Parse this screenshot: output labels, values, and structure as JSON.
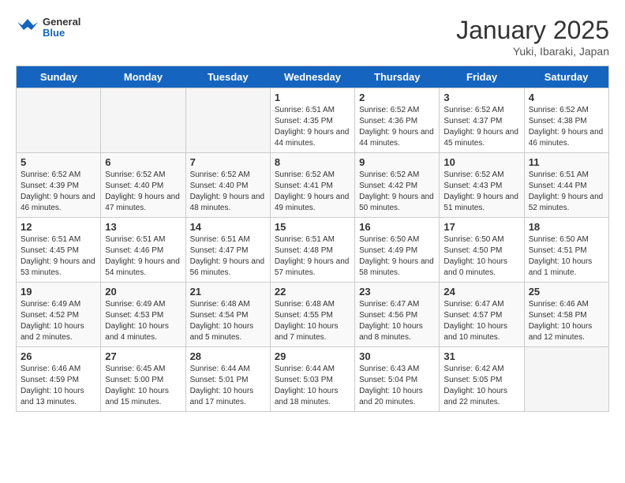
{
  "header": {
    "logo_general": "General",
    "logo_blue": "Blue",
    "title": "January 2025",
    "subtitle": "Yuki, Ibaraki, Japan"
  },
  "weekdays": [
    "Sunday",
    "Monday",
    "Tuesday",
    "Wednesday",
    "Thursday",
    "Friday",
    "Saturday"
  ],
  "weeks": [
    [
      {
        "day": "",
        "empty": true
      },
      {
        "day": "",
        "empty": true
      },
      {
        "day": "",
        "empty": true
      },
      {
        "day": "1",
        "sunrise": "Sunrise: 6:51 AM",
        "sunset": "Sunset: 4:35 PM",
        "daylight": "Daylight: 9 hours and 44 minutes."
      },
      {
        "day": "2",
        "sunrise": "Sunrise: 6:52 AM",
        "sunset": "Sunset: 4:36 PM",
        "daylight": "Daylight: 9 hours and 44 minutes."
      },
      {
        "day": "3",
        "sunrise": "Sunrise: 6:52 AM",
        "sunset": "Sunset: 4:37 PM",
        "daylight": "Daylight: 9 hours and 45 minutes."
      },
      {
        "day": "4",
        "sunrise": "Sunrise: 6:52 AM",
        "sunset": "Sunset: 4:38 PM",
        "daylight": "Daylight: 9 hours and 46 minutes."
      }
    ],
    [
      {
        "day": "5",
        "sunrise": "Sunrise: 6:52 AM",
        "sunset": "Sunset: 4:39 PM",
        "daylight": "Daylight: 9 hours and 46 minutes."
      },
      {
        "day": "6",
        "sunrise": "Sunrise: 6:52 AM",
        "sunset": "Sunset: 4:40 PM",
        "daylight": "Daylight: 9 hours and 47 minutes."
      },
      {
        "day": "7",
        "sunrise": "Sunrise: 6:52 AM",
        "sunset": "Sunset: 4:40 PM",
        "daylight": "Daylight: 9 hours and 48 minutes."
      },
      {
        "day": "8",
        "sunrise": "Sunrise: 6:52 AM",
        "sunset": "Sunset: 4:41 PM",
        "daylight": "Daylight: 9 hours and 49 minutes."
      },
      {
        "day": "9",
        "sunrise": "Sunrise: 6:52 AM",
        "sunset": "Sunset: 4:42 PM",
        "daylight": "Daylight: 9 hours and 50 minutes."
      },
      {
        "day": "10",
        "sunrise": "Sunrise: 6:52 AM",
        "sunset": "Sunset: 4:43 PM",
        "daylight": "Daylight: 9 hours and 51 minutes."
      },
      {
        "day": "11",
        "sunrise": "Sunrise: 6:51 AM",
        "sunset": "Sunset: 4:44 PM",
        "daylight": "Daylight: 9 hours and 52 minutes."
      }
    ],
    [
      {
        "day": "12",
        "sunrise": "Sunrise: 6:51 AM",
        "sunset": "Sunset: 4:45 PM",
        "daylight": "Daylight: 9 hours and 53 minutes."
      },
      {
        "day": "13",
        "sunrise": "Sunrise: 6:51 AM",
        "sunset": "Sunset: 4:46 PM",
        "daylight": "Daylight: 9 hours and 54 minutes."
      },
      {
        "day": "14",
        "sunrise": "Sunrise: 6:51 AM",
        "sunset": "Sunset: 4:47 PM",
        "daylight": "Daylight: 9 hours and 56 minutes."
      },
      {
        "day": "15",
        "sunrise": "Sunrise: 6:51 AM",
        "sunset": "Sunset: 4:48 PM",
        "daylight": "Daylight: 9 hours and 57 minutes."
      },
      {
        "day": "16",
        "sunrise": "Sunrise: 6:50 AM",
        "sunset": "Sunset: 4:49 PM",
        "daylight": "Daylight: 9 hours and 58 minutes."
      },
      {
        "day": "17",
        "sunrise": "Sunrise: 6:50 AM",
        "sunset": "Sunset: 4:50 PM",
        "daylight": "Daylight: 10 hours and 0 minutes."
      },
      {
        "day": "18",
        "sunrise": "Sunrise: 6:50 AM",
        "sunset": "Sunset: 4:51 PM",
        "daylight": "Daylight: 10 hours and 1 minute."
      }
    ],
    [
      {
        "day": "19",
        "sunrise": "Sunrise: 6:49 AM",
        "sunset": "Sunset: 4:52 PM",
        "daylight": "Daylight: 10 hours and 2 minutes."
      },
      {
        "day": "20",
        "sunrise": "Sunrise: 6:49 AM",
        "sunset": "Sunset: 4:53 PM",
        "daylight": "Daylight: 10 hours and 4 minutes."
      },
      {
        "day": "21",
        "sunrise": "Sunrise: 6:48 AM",
        "sunset": "Sunset: 4:54 PM",
        "daylight": "Daylight: 10 hours and 5 minutes."
      },
      {
        "day": "22",
        "sunrise": "Sunrise: 6:48 AM",
        "sunset": "Sunset: 4:55 PM",
        "daylight": "Daylight: 10 hours and 7 minutes."
      },
      {
        "day": "23",
        "sunrise": "Sunrise: 6:47 AM",
        "sunset": "Sunset: 4:56 PM",
        "daylight": "Daylight: 10 hours and 8 minutes."
      },
      {
        "day": "24",
        "sunrise": "Sunrise: 6:47 AM",
        "sunset": "Sunset: 4:57 PM",
        "daylight": "Daylight: 10 hours and 10 minutes."
      },
      {
        "day": "25",
        "sunrise": "Sunrise: 6:46 AM",
        "sunset": "Sunset: 4:58 PM",
        "daylight": "Daylight: 10 hours and 12 minutes."
      }
    ],
    [
      {
        "day": "26",
        "sunrise": "Sunrise: 6:46 AM",
        "sunset": "Sunset: 4:59 PM",
        "daylight": "Daylight: 10 hours and 13 minutes."
      },
      {
        "day": "27",
        "sunrise": "Sunrise: 6:45 AM",
        "sunset": "Sunset: 5:00 PM",
        "daylight": "Daylight: 10 hours and 15 minutes."
      },
      {
        "day": "28",
        "sunrise": "Sunrise: 6:44 AM",
        "sunset": "Sunset: 5:01 PM",
        "daylight": "Daylight: 10 hours and 17 minutes."
      },
      {
        "day": "29",
        "sunrise": "Sunrise: 6:44 AM",
        "sunset": "Sunset: 5:03 PM",
        "daylight": "Daylight: 10 hours and 18 minutes."
      },
      {
        "day": "30",
        "sunrise": "Sunrise: 6:43 AM",
        "sunset": "Sunset: 5:04 PM",
        "daylight": "Daylight: 10 hours and 20 minutes."
      },
      {
        "day": "31",
        "sunrise": "Sunrise: 6:42 AM",
        "sunset": "Sunset: 5:05 PM",
        "daylight": "Daylight: 10 hours and 22 minutes."
      },
      {
        "day": "",
        "empty": true
      }
    ]
  ]
}
